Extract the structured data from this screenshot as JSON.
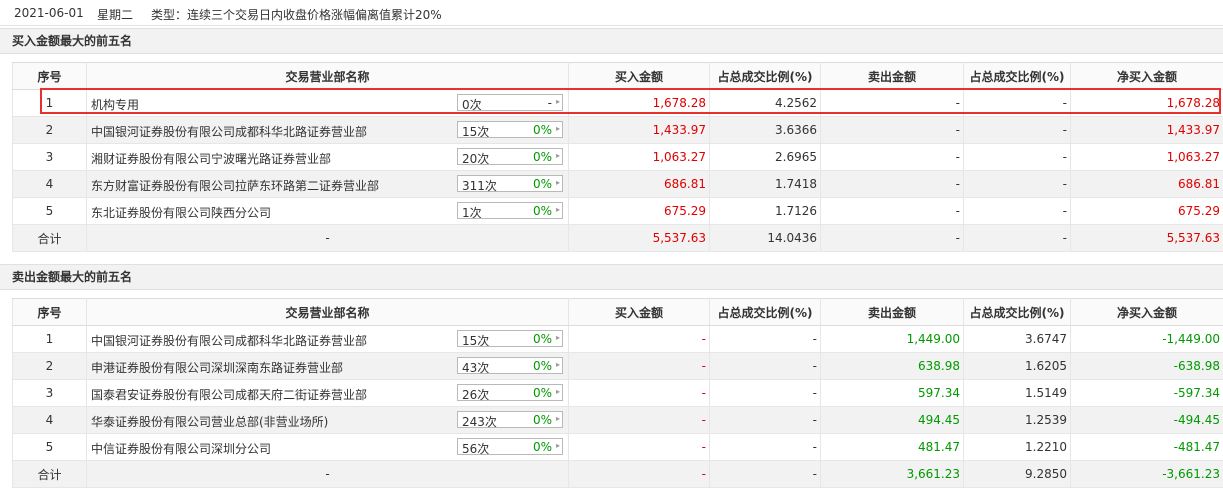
{
  "header": {
    "date": "2021-06-01",
    "weekday": "星期二",
    "type_text": "类型：连续三个交易日内收盘价格涨幅偏离值累计20%"
  },
  "columns": {
    "no": "序号",
    "name": "交易营业部名称",
    "buy": "买入金额",
    "buy_ratio": "占总成交比例(%)",
    "sell": "卖出金额",
    "sell_ratio": "占总成交比例(%)",
    "net": "净买入金额"
  },
  "buy_section": {
    "title": "买入金额最大的前五名",
    "rows": [
      {
        "no": "1",
        "name": "机构专用",
        "count": "0次",
        "pct": "-",
        "buy": "1,678.28",
        "buy_ratio": "4.2562",
        "sell": "-",
        "sell_ratio": "-",
        "net": "1,678.28"
      },
      {
        "no": "2",
        "name": "中国银河证券股份有限公司成都科华北路证券营业部",
        "count": "15次",
        "pct": "0%",
        "buy": "1,433.97",
        "buy_ratio": "3.6366",
        "sell": "-",
        "sell_ratio": "-",
        "net": "1,433.97"
      },
      {
        "no": "3",
        "name": "湘财证券股份有限公司宁波曙光路证券营业部",
        "count": "20次",
        "pct": "0%",
        "buy": "1,063.27",
        "buy_ratio": "2.6965",
        "sell": "-",
        "sell_ratio": "-",
        "net": "1,063.27"
      },
      {
        "no": "4",
        "name": "东方财富证券股份有限公司拉萨东环路第二证券营业部",
        "count": "311次",
        "pct": "0%",
        "buy": "686.81",
        "buy_ratio": "1.7418",
        "sell": "-",
        "sell_ratio": "-",
        "net": "686.81"
      },
      {
        "no": "5",
        "name": "东北证券股份有限公司陕西分公司",
        "count": "1次",
        "pct": "0%",
        "buy": "675.29",
        "buy_ratio": "1.7126",
        "sell": "-",
        "sell_ratio": "-",
        "net": "675.29"
      }
    ],
    "total": {
      "label": "合计",
      "name": "-",
      "buy": "5,537.63",
      "buy_ratio": "14.0436",
      "sell": "-",
      "sell_ratio": "-",
      "net": "5,537.63"
    }
  },
  "sell_section": {
    "title": "卖出金额最大的前五名",
    "rows": [
      {
        "no": "1",
        "name": "中国银河证券股份有限公司成都科华北路证券营业部",
        "count": "15次",
        "pct": "0%",
        "buy": "-",
        "buy_ratio": "-",
        "sell": "1,449.00",
        "sell_ratio": "3.6747",
        "net": "-1,449.00"
      },
      {
        "no": "2",
        "name": "申港证券股份有限公司深圳深南东路证券营业部",
        "count": "43次",
        "pct": "0%",
        "buy": "-",
        "buy_ratio": "-",
        "sell": "638.98",
        "sell_ratio": "1.6205",
        "net": "-638.98"
      },
      {
        "no": "3",
        "name": "国泰君安证券股份有限公司成都天府二街证券营业部",
        "count": "26次",
        "pct": "0%",
        "buy": "-",
        "buy_ratio": "-",
        "sell": "597.34",
        "sell_ratio": "1.5149",
        "net": "-597.34"
      },
      {
        "no": "4",
        "name": "华泰证券股份有限公司营业总部(非营业场所)",
        "count": "243次",
        "pct": "0%",
        "buy": "-",
        "buy_ratio": "-",
        "sell": "494.45",
        "sell_ratio": "1.2539",
        "net": "-494.45"
      },
      {
        "no": "5",
        "name": "中信证券股份有限公司深圳分公司",
        "count": "56次",
        "pct": "0%",
        "buy": "-",
        "buy_ratio": "-",
        "sell": "481.47",
        "sell_ratio": "1.2210",
        "net": "-481.47"
      }
    ],
    "total": {
      "label": "合计",
      "name": "-",
      "buy": "-",
      "buy_ratio": "-",
      "sell": "3,661.23",
      "sell_ratio": "9.2850",
      "net": "-3,661.23"
    }
  },
  "colors": {
    "positive": "#e00000",
    "negative": "#009900",
    "highlight_border": "#e8312a"
  }
}
